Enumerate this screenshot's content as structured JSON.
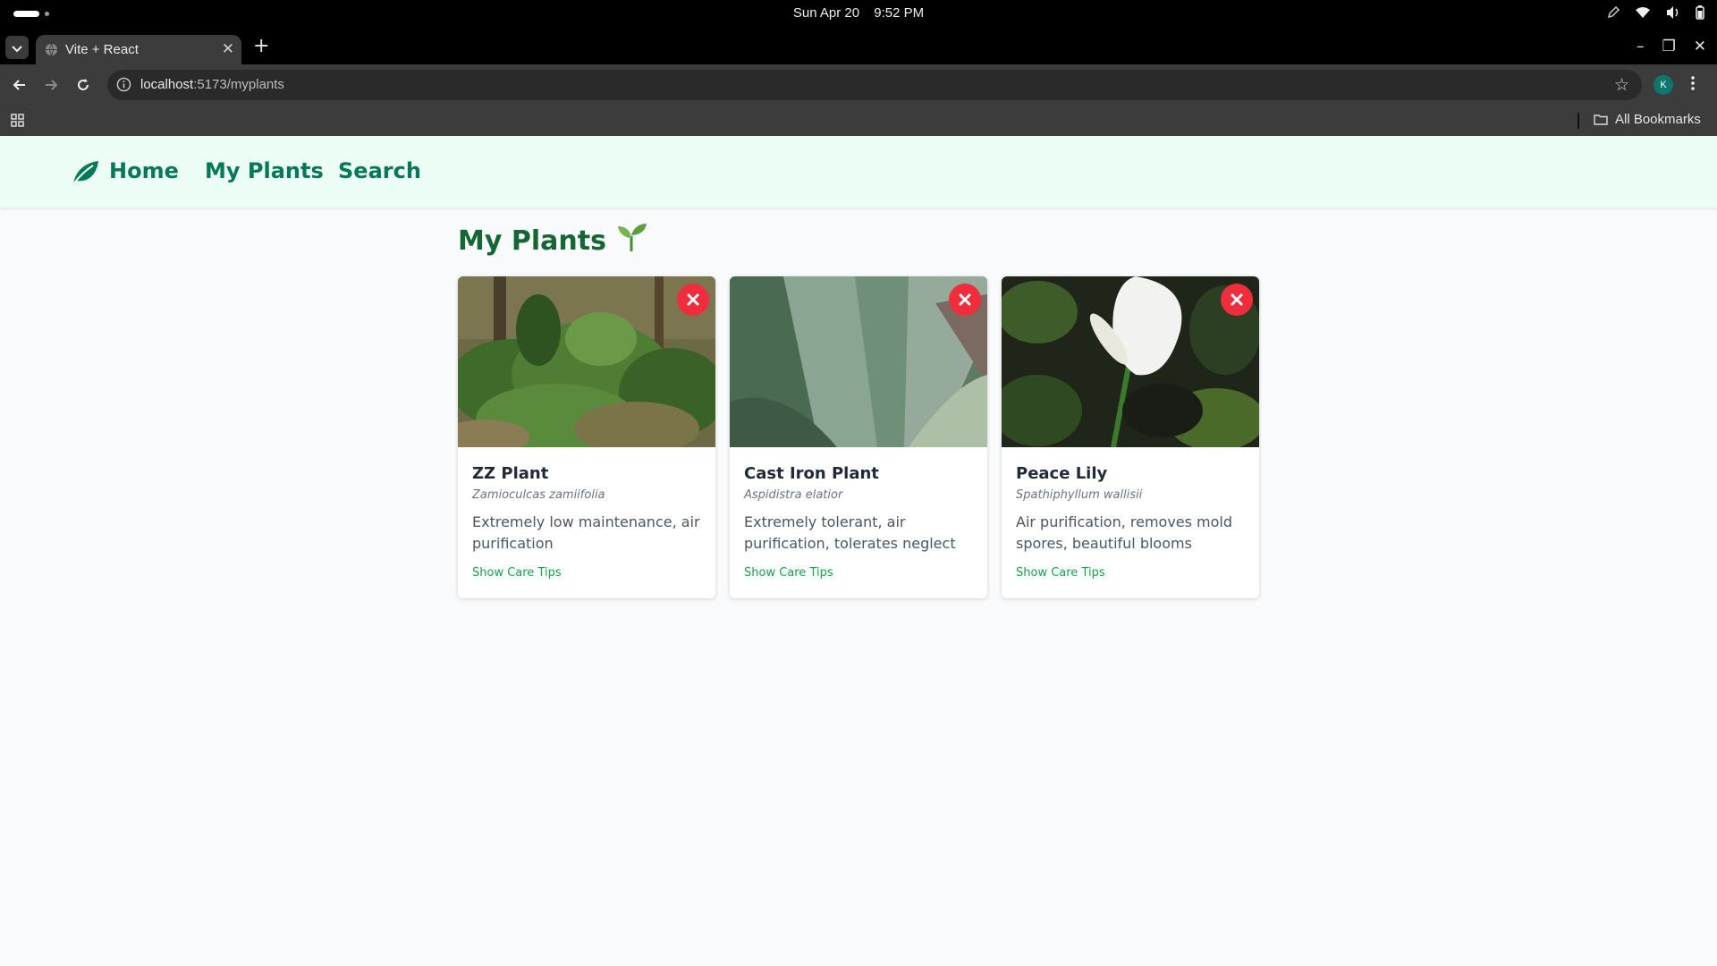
{
  "os": {
    "date": "Sun Apr 20",
    "time": "9:52 PM"
  },
  "browser": {
    "tab_title": "Vite + React",
    "url_host": "localhost",
    "url_path": ":5173/myplants",
    "profile_initial": "K",
    "bookmarks_label": "All Bookmarks"
  },
  "nav": {
    "home": "Home",
    "my_plants": "My Plants",
    "search": "Search"
  },
  "page": {
    "title": "My Plants",
    "title_emoji": "🌱"
  },
  "plants": [
    {
      "name": "ZZ Plant",
      "scientific": "Zamioculcas zamiifolia",
      "description": "Extremely low maintenance, air purification",
      "link": "Show Care Tips"
    },
    {
      "name": "Cast Iron Plant",
      "scientific": "Aspidistra elatior",
      "description": "Extremely tolerant, air purification, tolerates neglect",
      "link": "Show Care Tips"
    },
    {
      "name": "Peace Lily",
      "scientific": "Spathiphyllum wallisii",
      "description": "Air purification, removes mold spores, beautiful blooms",
      "link": "Show Care Tips"
    }
  ],
  "colors": {
    "nav_bg": "#ecfdf5",
    "nav_text": "#047857",
    "title": "#166534",
    "link": "#16a34a",
    "remove": "#ef2d3c"
  }
}
